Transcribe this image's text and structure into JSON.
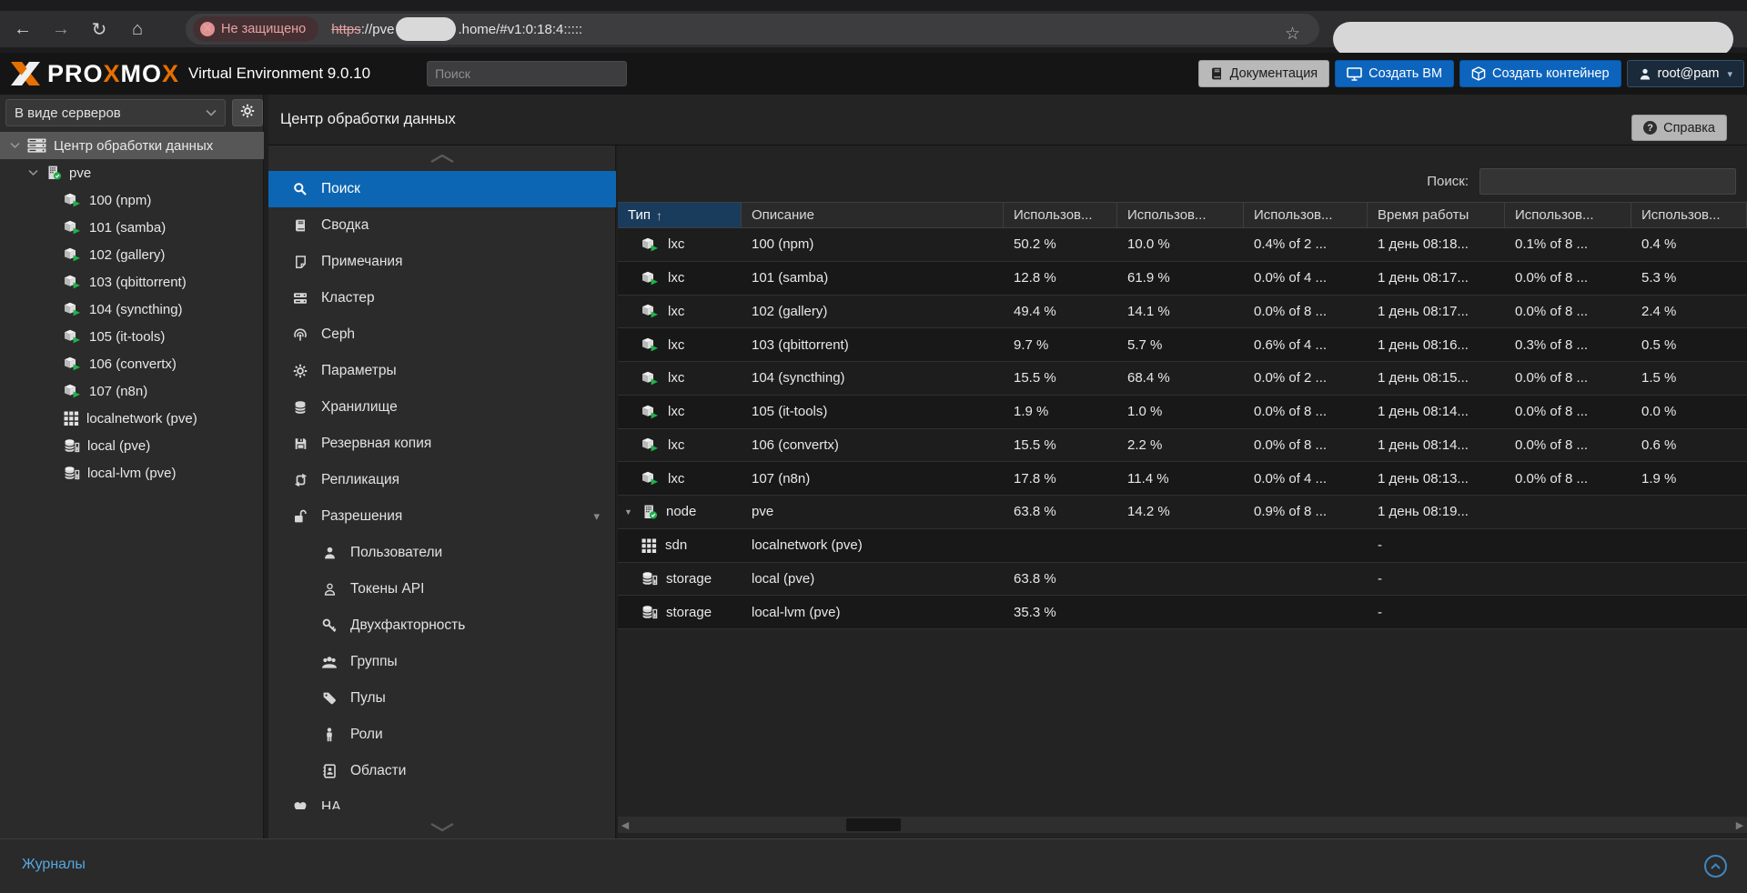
{
  "colors": {
    "accent_blue": "#0d64bc",
    "selection_blue": "#0d66b3",
    "sorted_header_blue": "#1a3c5c",
    "running_green": "#21b14c",
    "insecure_red": "#e8a2a2",
    "footer_link_blue": "#55a8e0"
  },
  "browser": {
    "back_icon": "back-arrow",
    "forward_icon": "forward-arrow",
    "reload_icon": "reload",
    "home_icon": "home",
    "security_badge": "Не защищено",
    "url_protocol": "https",
    "url_mid": "://pve",
    "url_tail": ".home/#v1:0:18:4:::::",
    "star_icon": "☆"
  },
  "header": {
    "logo": {
      "p1": "PRO",
      "x1": "X",
      "p2": "MO",
      "x2": "X"
    },
    "subtitle": "Virtual Environment 9.0.10",
    "search_placeholder": "Поиск",
    "buttons": [
      {
        "label": "Документация",
        "style": "gray",
        "icon": "book-dark"
      },
      {
        "label": "Создать ВМ",
        "style": "blue",
        "icon": "monitor"
      },
      {
        "label": "Создать контейнер",
        "style": "blue",
        "icon": "cube-outline"
      },
      {
        "label": "root@pam",
        "style": "dark",
        "icon": "user-white",
        "caret": true
      }
    ]
  },
  "sidebar": {
    "view_select": "В виде серверов",
    "gear_icon": "gear",
    "tree": [
      {
        "label": "Центр обработки данных",
        "icon": "datacenter",
        "level": 0,
        "selected": true,
        "expander": true
      },
      {
        "label": "pve",
        "icon": "node",
        "level": 1,
        "selected": false,
        "expander": true
      },
      {
        "label": "100 (npm)",
        "icon": "lxc",
        "level": 2
      },
      {
        "label": "101 (samba)",
        "icon": "lxc",
        "level": 2
      },
      {
        "label": "102 (gallery)",
        "icon": "lxc",
        "level": 2
      },
      {
        "label": "103 (qbittorrent)",
        "icon": "lxc",
        "level": 2
      },
      {
        "label": "104 (syncthing)",
        "icon": "lxc",
        "level": 2
      },
      {
        "label": "105 (it-tools)",
        "icon": "lxc",
        "level": 2
      },
      {
        "label": "106 (convertx)",
        "icon": "lxc",
        "level": 2
      },
      {
        "label": "107 (n8n)",
        "icon": "lxc",
        "level": 2
      },
      {
        "label": "localnetwork (pve)",
        "icon": "sdn",
        "level": 2
      },
      {
        "label": "local (pve)",
        "icon": "storage-tree",
        "level": 2
      },
      {
        "label": "local-lvm (pve)",
        "icon": "storage-tree",
        "level": 2
      }
    ]
  },
  "content": {
    "title": "Центр обработки данных",
    "help_button": "Справка"
  },
  "nav": {
    "items": [
      {
        "label": "Поиск",
        "icon": "search",
        "selected": true
      },
      {
        "label": "Сводка",
        "icon": "book"
      },
      {
        "label": "Примечания",
        "icon": "note"
      },
      {
        "label": "Кластер",
        "icon": "cluster"
      },
      {
        "label": "Ceph",
        "icon": "ceph"
      },
      {
        "label": "Параметры",
        "icon": "gear"
      },
      {
        "label": "Хранилище",
        "icon": "storage"
      },
      {
        "label": "Резервная копия",
        "icon": "floppy"
      },
      {
        "label": "Репликация",
        "icon": "replication"
      },
      {
        "label": "Разрешения",
        "icon": "unlock",
        "expandable": true
      },
      {
        "label": "Пользователи",
        "icon": "user",
        "indent": true
      },
      {
        "label": "Токены API",
        "icon": "user-outline",
        "indent": true
      },
      {
        "label": "Двухфакторность",
        "icon": "key",
        "indent": true
      },
      {
        "label": "Группы",
        "icon": "users",
        "indent": true
      },
      {
        "label": "Пулы",
        "icon": "tags",
        "indent": true
      },
      {
        "label": "Роли",
        "icon": "person",
        "indent": true
      },
      {
        "label": "Области",
        "icon": "address-book",
        "indent": true
      },
      {
        "label": "HA",
        "icon": "ha"
      }
    ]
  },
  "table": {
    "filter_label": "Поиск:",
    "filter_value": "",
    "columns": [
      {
        "label": "Тип",
        "sorted": true
      },
      {
        "label": "Описание"
      },
      {
        "label": "Использов..."
      },
      {
        "label": "Использов..."
      },
      {
        "label": "Использов..."
      },
      {
        "label": "Время работы"
      },
      {
        "label": "Использов..."
      },
      {
        "label": "Использов..."
      }
    ],
    "rows": [
      {
        "type": "lxc",
        "icon": "lxc",
        "cells": [
          "100 (npm)",
          "50.2 %",
          "10.0 %",
          "0.4% of 2 ...",
          "1 день 08:18...",
          "0.1% of 8 ...",
          "0.4 %"
        ]
      },
      {
        "type": "lxc",
        "icon": "lxc",
        "cells": [
          "101 (samba)",
          "12.8 %",
          "61.9 %",
          "0.0% of 4 ...",
          "1 день 08:17...",
          "0.0% of 8 ...",
          "5.3 %"
        ]
      },
      {
        "type": "lxc",
        "icon": "lxc",
        "cells": [
          "102 (gallery)",
          "49.4 %",
          "14.1 %",
          "0.0% of 8 ...",
          "1 день 08:17...",
          "0.0% of 8 ...",
          "2.4 %"
        ]
      },
      {
        "type": "lxc",
        "icon": "lxc",
        "cells": [
          "103 (qbittorrent)",
          "9.7 %",
          "5.7 %",
          "0.6% of 4 ...",
          "1 день 08:16...",
          "0.3% of 8 ...",
          "0.5 %"
        ]
      },
      {
        "type": "lxc",
        "icon": "lxc",
        "cells": [
          "104 (syncthing)",
          "15.5 %",
          "68.4 %",
          "0.0% of 2 ...",
          "1 день 08:15...",
          "0.0% of 8 ...",
          "1.5 %"
        ]
      },
      {
        "type": "lxc",
        "icon": "lxc",
        "cells": [
          "105 (it-tools)",
          "1.9 %",
          "1.0 %",
          "0.0% of 8 ...",
          "1 день 08:14...",
          "0.0% of 8 ...",
          "0.0 %"
        ]
      },
      {
        "type": "lxc",
        "icon": "lxc",
        "cells": [
          "106 (convertx)",
          "15.5 %",
          "2.2 %",
          "0.0% of 8 ...",
          "1 день 08:14...",
          "0.0% of 8 ...",
          "0.6 %"
        ]
      },
      {
        "type": "lxc",
        "icon": "lxc",
        "cells": [
          "107 (n8n)",
          "17.8 %",
          "11.4 %",
          "0.0% of 4 ...",
          "1 день 08:13...",
          "0.0% of 8 ...",
          "1.9 %"
        ]
      },
      {
        "type": "node",
        "icon": "node",
        "expander": true,
        "cells": [
          "pve",
          "63.8 %",
          "14.2 %",
          "0.9% of 8 ...",
          "1 день 08:19...",
          "",
          ""
        ]
      },
      {
        "type": "sdn",
        "icon": "sdn",
        "cells": [
          "localnetwork (pve)",
          "",
          "",
          "",
          "-",
          "",
          ""
        ]
      },
      {
        "type": "storage",
        "icon": "storage-tree",
        "cells": [
          "local (pve)",
          "63.8 %",
          "",
          "",
          "-",
          "",
          ""
        ]
      },
      {
        "type": "storage",
        "icon": "storage-tree",
        "cells": [
          "local-lvm (pve)",
          "35.3 %",
          "",
          "",
          "-",
          "",
          ""
        ]
      }
    ]
  },
  "footer": {
    "logs_label": "Журналы",
    "scroll_top_icon": "chevron-up-circle"
  }
}
